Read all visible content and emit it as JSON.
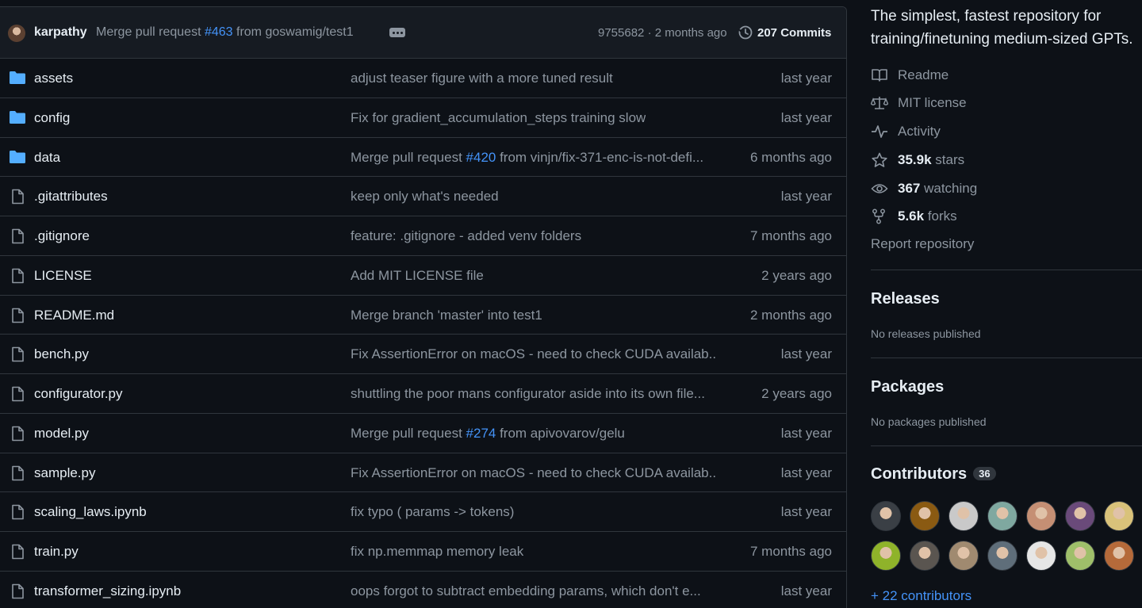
{
  "latest_commit": {
    "author": "karpathy",
    "message_prefix": "Merge pull request ",
    "message_link": "#463",
    "message_suffix": " from goswamig/test1",
    "sha_time": "9755682 · 2 months ago",
    "commits_label": "207 Commits"
  },
  "files": [
    {
      "type": "folder",
      "name": "assets",
      "msg": "adjust teaser figure with a more tuned result",
      "age": "last year"
    },
    {
      "type": "folder",
      "name": "config",
      "msg": "Fix for gradient_accumulation_steps training slow",
      "age": "last year"
    },
    {
      "type": "folder",
      "name": "data",
      "msg_pre": "Merge pull request ",
      "msg_link": "#420",
      "msg_post": " from vinjn/fix-371-enc-is-not-defi...",
      "age": "6 months ago"
    },
    {
      "type": "file",
      "name": ".gitattributes",
      "msg": "keep only what's needed",
      "age": "last year"
    },
    {
      "type": "file",
      "name": ".gitignore",
      "msg": "feature: .gitignore - added venv folders",
      "age": "7 months ago"
    },
    {
      "type": "file",
      "name": "LICENSE",
      "msg": "Add MIT LICENSE file",
      "age": "2 years ago"
    },
    {
      "type": "file",
      "name": "README.md",
      "msg": "Merge branch 'master' into test1",
      "age": "2 months ago"
    },
    {
      "type": "file",
      "name": "bench.py",
      "msg": "Fix AssertionError on macOS - need to check CUDA availab...",
      "age": "last year"
    },
    {
      "type": "file",
      "name": "configurator.py",
      "msg": "shuttling the poor mans configurator aside into its own file...",
      "age": "2 years ago"
    },
    {
      "type": "file",
      "name": "model.py",
      "msg_pre": "Merge pull request ",
      "msg_link": "#274",
      "msg_post": " from apivovarov/gelu",
      "age": "last year"
    },
    {
      "type": "file",
      "name": "sample.py",
      "msg": "Fix AssertionError on macOS - need to check CUDA availab...",
      "age": "last year"
    },
    {
      "type": "file",
      "name": "scaling_laws.ipynb",
      "msg": "fix typo ( params -> tokens)",
      "age": "last year"
    },
    {
      "type": "file",
      "name": "train.py",
      "msg": "fix np.memmap memory leak",
      "age": "7 months ago"
    },
    {
      "type": "file",
      "name": "transformer_sizing.ipynb",
      "msg": "oops forgot to subtract embedding params, which don't e...",
      "age": "last year"
    }
  ],
  "sidebar": {
    "about": "The simplest, fastest repository for\ntraining/finetuning medium-sized GPTs.",
    "readme": "Readme",
    "license": "MIT license",
    "activity": "Activity",
    "stars_count": "35.9k",
    "stars_label": " stars",
    "watching_count": "367",
    "watching_label": " watching",
    "forks_count": "5.6k",
    "forks_label": " forks",
    "report": "Report repository",
    "releases_title": "Releases",
    "releases_note": "No releases published",
    "packages_title": "Packages",
    "packages_note": "No packages published",
    "contributors_title": "Contributors",
    "contributors_count": "36",
    "more_contributors": "+ 22 contributors"
  },
  "colors": {
    "background": "#0d1117",
    "header_bg": "#161b22",
    "border": "#30363d",
    "text": "#e6edf3",
    "muted": "#8d96a0",
    "link": "#4493f8",
    "folder": "#54aeff"
  },
  "contributor_avatars": [
    "#3a3f45",
    "#8a5a12",
    "#c9c9c9",
    "#7fa8a0",
    "#c58f74",
    "#6a4a7a",
    "#d9c27a",
    "#8fb32a",
    "#5a5550",
    "#a08a70",
    "#5f6e7a",
    "#e6e6e6",
    "#9fbf6a",
    "#b56a3a"
  ]
}
